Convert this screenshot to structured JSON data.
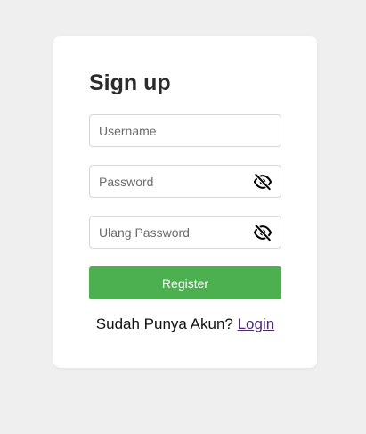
{
  "form": {
    "title": "Sign up",
    "username_placeholder": "Username",
    "password_placeholder": "Password",
    "repeat_password_placeholder": "Ulang Password",
    "register_label": "Register",
    "login_prompt": "Sudah Punya Akun?",
    "login_link": "Login"
  },
  "icons": {
    "password_toggle": "eye-slash-icon",
    "repeat_password_toggle": "eye-slash-icon"
  },
  "colors": {
    "background": "#efefef",
    "card": "#ffffff",
    "button": "#4caf50",
    "button_text": "#ffffff",
    "link": "#4a2c6b",
    "title": "#2b2b2b"
  }
}
